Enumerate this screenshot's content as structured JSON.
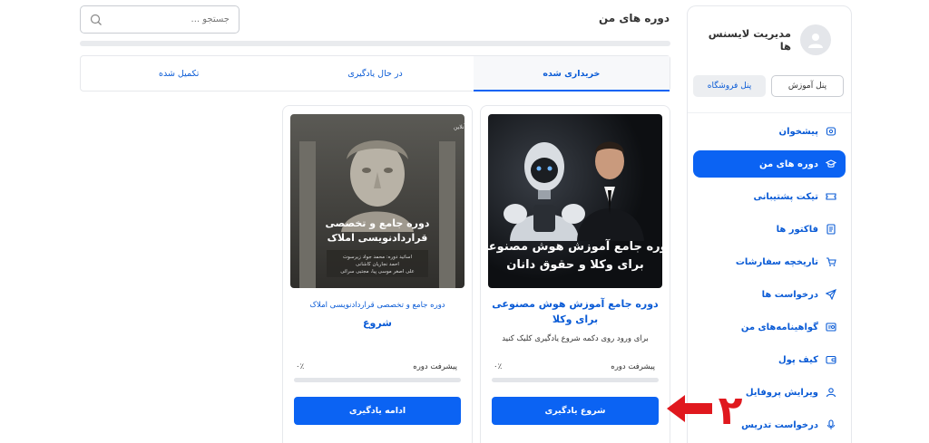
{
  "sidebar": {
    "profile_name": "مدیریت لایسنس ها",
    "panels": [
      {
        "label": "پنل آموزش",
        "active": true
      },
      {
        "label": "پنل فروشگاه",
        "active": false
      }
    ],
    "items": [
      {
        "label": "پیشخوان",
        "icon": "home-icon"
      },
      {
        "label": "دوره های من",
        "icon": "graduation-cap-icon",
        "active": true
      },
      {
        "label": "تیکت پشتیبانی",
        "icon": "ticket-icon"
      },
      {
        "label": "فاکتور ها",
        "icon": "invoice-icon"
      },
      {
        "label": "تاریخچه سفارشات",
        "icon": "cart-icon"
      },
      {
        "label": "درخواست ها",
        "icon": "send-icon"
      },
      {
        "label": "گواهینامه‌های من",
        "icon": "certificate-icon"
      },
      {
        "label": "کیف پول",
        "icon": "wallet-icon"
      },
      {
        "label": "ویرایش پروفایل",
        "icon": "user-icon"
      },
      {
        "label": "درخواست تدریس",
        "icon": "microphone-icon"
      }
    ]
  },
  "header": {
    "title": "دوره های من",
    "search_placeholder": "جستجو ..."
  },
  "tabs": [
    {
      "label": "خریداری شده",
      "active": true
    },
    {
      "label": "در حال یادگیری",
      "active": false
    },
    {
      "label": "تکمیل شده",
      "active": false
    }
  ],
  "courses": [
    {
      "image_text_line1": "دوره جامع آموزش هوش مصنوعی",
      "image_text_line2": "برای وکلا و حقوق دانان",
      "title": "دوره جامع آموزش هوش مصنوعی برای وکلا",
      "subtitle": "برای ورود روی دکمه شروع یادگیری کلیک کنید",
      "progress_label": "پیشرفت دوره",
      "progress_text": "۰٪",
      "progress": 0,
      "button_label": "شروع یادگیری"
    },
    {
      "image_brand": "مدرسه حقوق آنلاین",
      "image_text_line1": "دوره جامع و تخصصی",
      "image_text_line2": "قراردادنویسی املاک",
      "image_credit1": "اساتید دوره: محمد جواد زیرسوت",
      "image_credit2": "احمد نجاریان کاشانی",
      "image_credit3": "علی اصغر موسی پیا، مجتبی سرائی",
      "title": "دوره جامع و تخصصی قراردادنویسی املاک",
      "subtitle": "شروع",
      "progress_label": "پیشرفت دوره",
      "progress_text": "۰٪",
      "progress": 0,
      "button_label": "ادامه یادگیری"
    }
  ],
  "annotation": {
    "number": "۲",
    "color": "#e0181e"
  },
  "colors": {
    "primary": "#0b63f3",
    "link": "#0a5bd6"
  }
}
